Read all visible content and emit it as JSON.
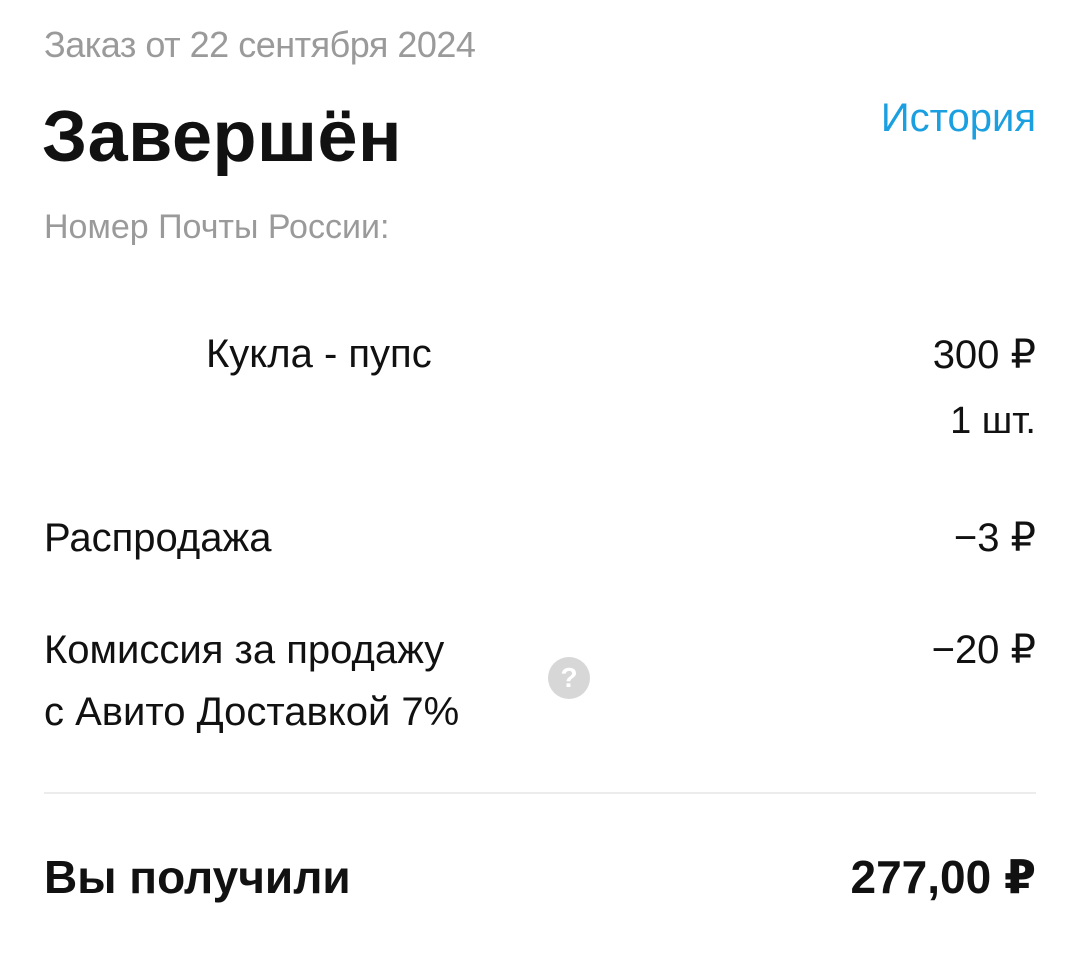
{
  "header": {
    "order_date": "Заказ от 22 сентября 2024",
    "status": "Завершён",
    "history_link": "История",
    "tracking_label": "Номер Почты России:"
  },
  "item": {
    "name": "Кукла - пупс",
    "price": "300 ₽",
    "quantity": "1 шт."
  },
  "discount": {
    "label": "Распродажа",
    "value": "−3 ₽"
  },
  "commission": {
    "label_line1": "Комиссия за продажу",
    "label_line2": "с Авито Доставкой 7%",
    "value": "−20 ₽",
    "help_icon_glyph": "?",
    "help_icon": "question-circle-icon"
  },
  "total": {
    "label": "Вы получили",
    "value": "277,00 ₽"
  },
  "colors": {
    "link": "#1a9fe0",
    "muted": "#9a9a9a",
    "text": "#111111",
    "divider": "#ececec",
    "help_icon_bg": "#d7d7d7"
  }
}
